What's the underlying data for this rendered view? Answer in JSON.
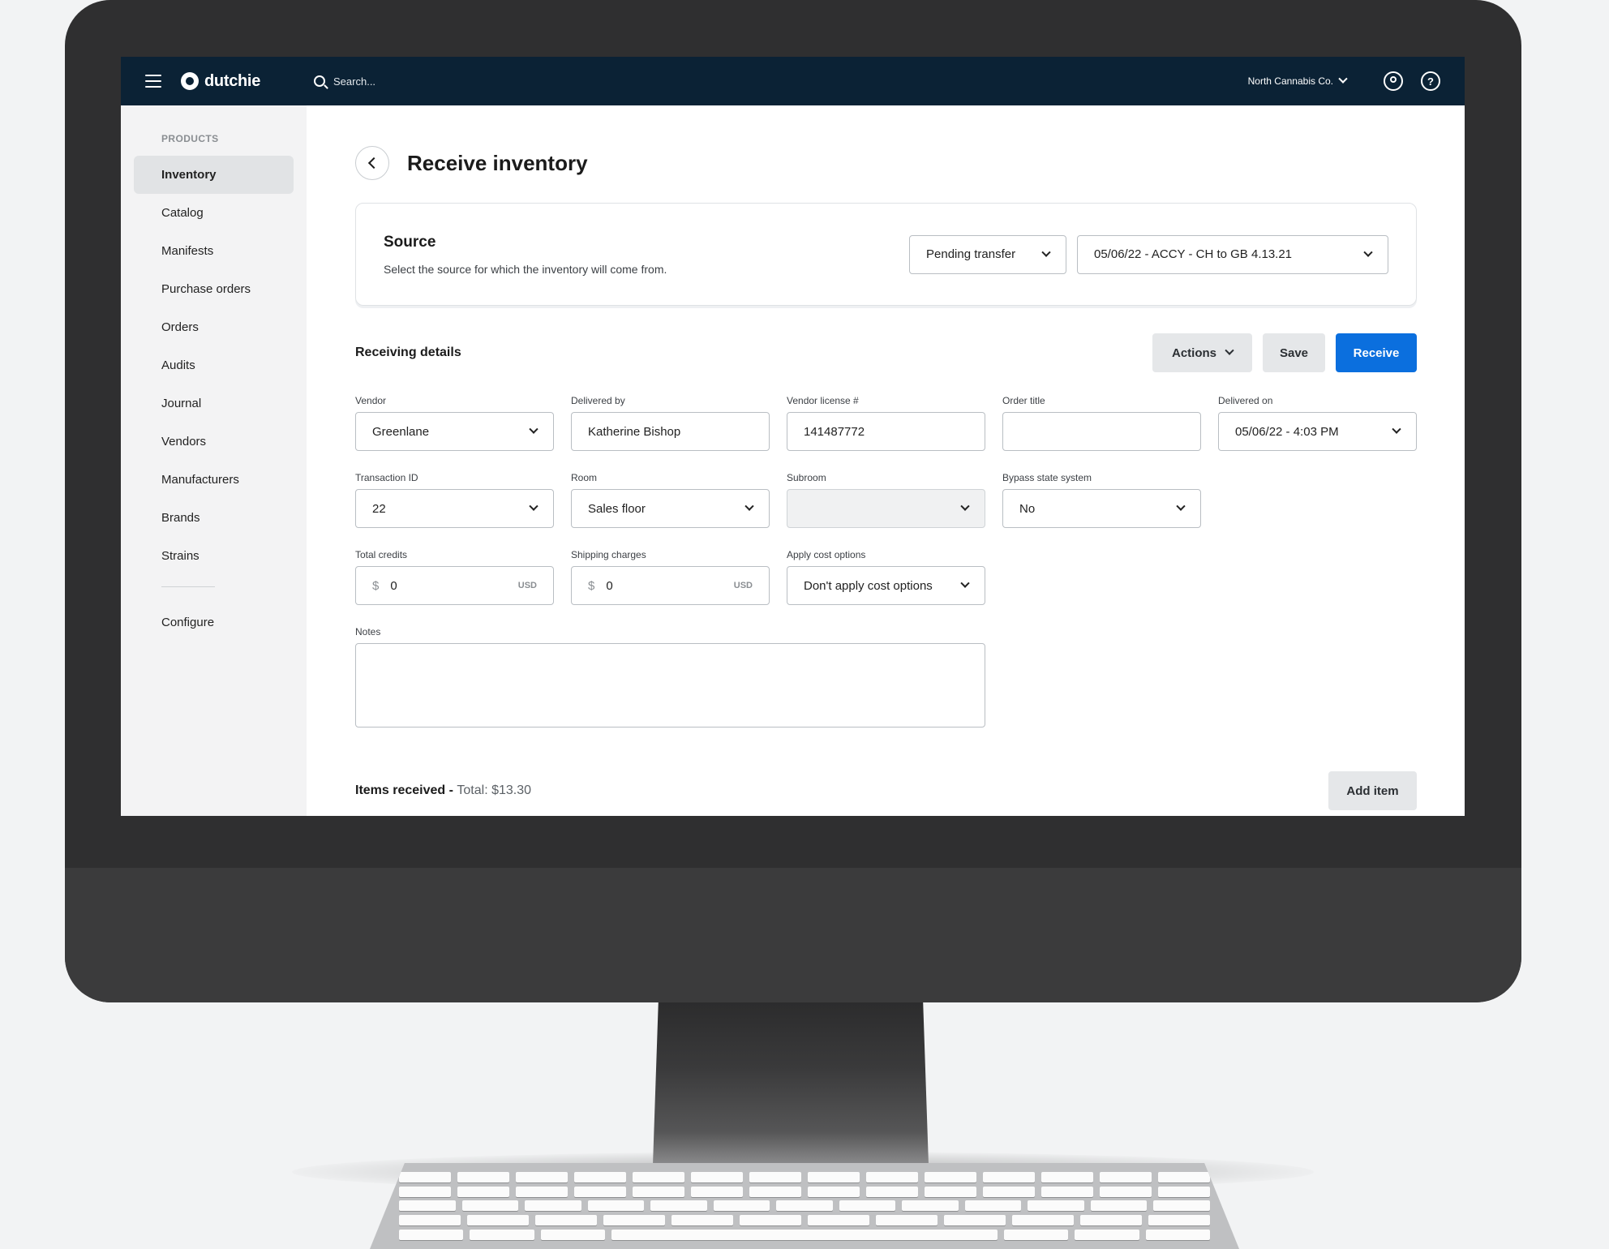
{
  "topbar": {
    "logo_text": "dutchie",
    "search_placeholder": "Search...",
    "org_name": "North Cannabis Co."
  },
  "sidebar": {
    "section_label": "PRODUCTS",
    "items": [
      {
        "label": "Inventory",
        "active": true
      },
      {
        "label": "Catalog"
      },
      {
        "label": "Manifests"
      },
      {
        "label": "Purchase orders"
      },
      {
        "label": "Orders"
      },
      {
        "label": "Audits"
      },
      {
        "label": "Journal"
      },
      {
        "label": "Vendors"
      },
      {
        "label": "Manufacturers"
      },
      {
        "label": "Brands"
      },
      {
        "label": "Strains"
      }
    ],
    "configure_label": "Configure"
  },
  "page": {
    "title": "Receive inventory"
  },
  "source": {
    "title": "Source",
    "description": "Select the source for which the inventory will come from.",
    "type_value": "Pending transfer",
    "transfer_value": "05/06/22 - ACCY - CH to GB 4.13.21"
  },
  "receiving": {
    "title": "Receiving details",
    "actions_label": "Actions",
    "save_label": "Save",
    "receive_label": "Receive",
    "fields": {
      "vendor": {
        "label": "Vendor",
        "value": "Greenlane"
      },
      "delivered_by": {
        "label": "Delivered by",
        "value": "Katherine Bishop"
      },
      "vendor_license": {
        "label": "Vendor license #",
        "value": "141487772"
      },
      "order_title": {
        "label": "Order title",
        "value": ""
      },
      "delivered_on": {
        "label": "Delivered on",
        "value": "05/06/22 - 4:03 PM"
      },
      "transaction_id": {
        "label": "Transaction ID",
        "value": "22"
      },
      "room": {
        "label": "Room",
        "value": "Sales floor"
      },
      "subroom": {
        "label": "Subroom",
        "value": ""
      },
      "bypass_state": {
        "label": "Bypass state system",
        "value": "No"
      },
      "total_credits": {
        "label": "Total credits",
        "currency_symbol": "$",
        "value": "0",
        "unit": "USD"
      },
      "shipping_charges": {
        "label": "Shipping charges",
        "currency_symbol": "$",
        "value": "0",
        "unit": "USD"
      },
      "apply_cost": {
        "label": "Apply cost options",
        "value": "Don't apply cost options"
      },
      "notes": {
        "label": "Notes",
        "value": ""
      }
    }
  },
  "items_received": {
    "title": "Items received",
    "separator": " - ",
    "total_text": "Total: $13.30",
    "add_item_label": "Add item"
  },
  "colors": {
    "topbar_bg": "#0b2235",
    "primary_button": "#0b6fde",
    "sidebar_bg": "#f3f3f4"
  }
}
